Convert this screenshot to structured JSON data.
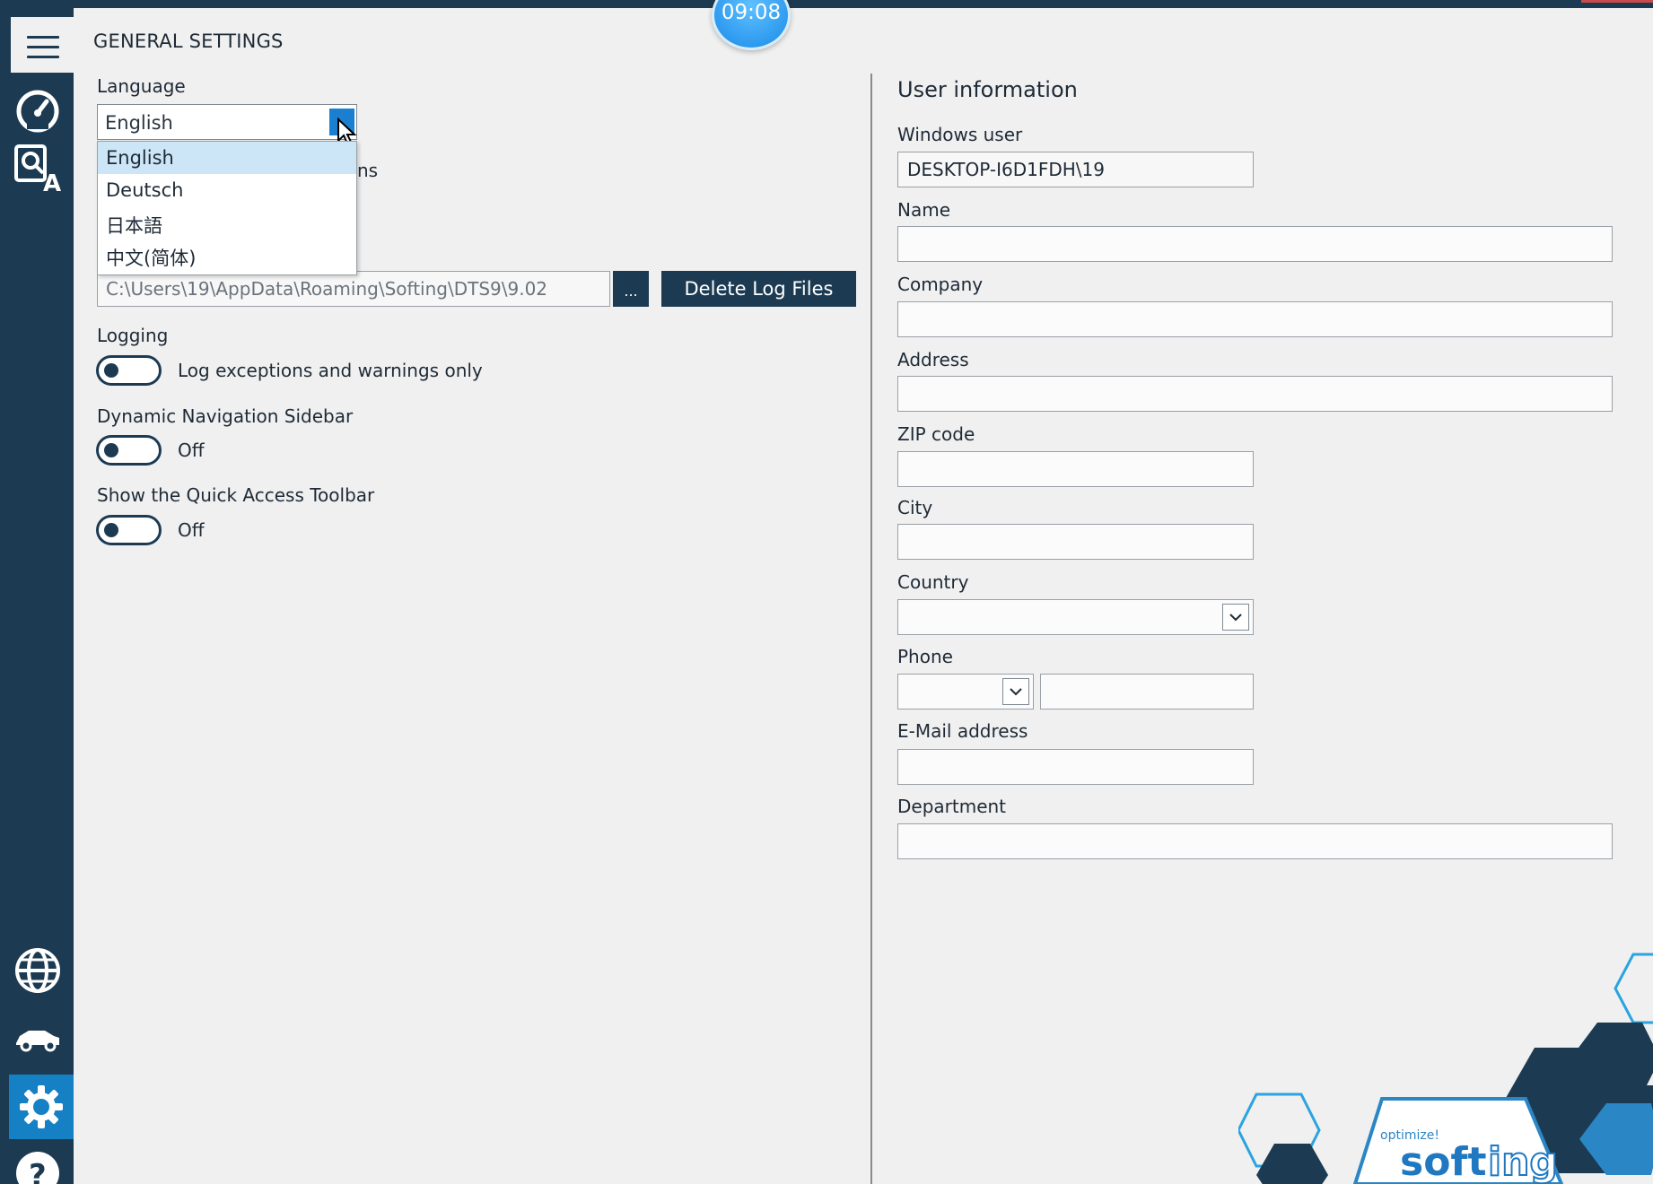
{
  "window": {
    "title": "GENERAL SETTINGS",
    "clock": "09:08"
  },
  "sidebar": {
    "items": [
      {
        "name": "dashboard",
        "icon": "speedometer-icon"
      },
      {
        "name": "translation",
        "icon": "translate-icon"
      },
      {
        "name": "network",
        "icon": "globe-icon"
      },
      {
        "name": "vehicle",
        "icon": "car-icon"
      },
      {
        "name": "settings",
        "icon": "gear-icon",
        "active": true
      },
      {
        "name": "help",
        "icon": "help-icon"
      }
    ]
  },
  "left": {
    "language_label": "Language",
    "language_value": "English",
    "language_options": [
      "English",
      "Deutsch",
      "日本語",
      "中文(简体)"
    ],
    "hidden_suffix": "ns",
    "log_path": "C:\\Users\\19\\AppData\\Roaming\\Softing\\DTS9\\9.02",
    "browse_label": "...",
    "delete_label": "Delete Log Files",
    "logging_label": "Logging",
    "logging_toggle_text": "Log exceptions and warnings only",
    "dyn_nav_label": "Dynamic Navigation Sidebar",
    "dyn_nav_state": "Off",
    "quick_access_label": "Show the Quick Access Toolbar",
    "quick_access_state": "Off"
  },
  "right": {
    "heading": "User information",
    "windows_user_label": "Windows user",
    "windows_user_value": "DESKTOP-I6D1FDH\\19",
    "name_label": "Name",
    "company_label": "Company",
    "address_label": "Address",
    "zip_label": "ZIP code",
    "city_label": "City",
    "country_label": "Country",
    "phone_label": "Phone",
    "email_label": "E-Mail address",
    "department_label": "Department"
  },
  "brand": {
    "tagline": "optimize!",
    "name_a": "soft",
    "name_b": "ing"
  },
  "colors": {
    "sidebar": "#1c3b53",
    "accent": "#1a7fd0",
    "background": "#f0f0f0"
  }
}
